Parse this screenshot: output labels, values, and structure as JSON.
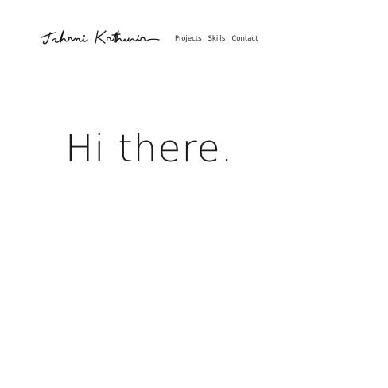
{
  "header": {
    "logo_text": "Ishani Kathuria",
    "nav": [
      {
        "label": "Projects"
      },
      {
        "label": "Skills"
      },
      {
        "label": "Contact"
      }
    ]
  },
  "hero": {
    "greeting": "Hi there."
  },
  "colors": {
    "background": "#ffffff",
    "text": "#111111"
  }
}
